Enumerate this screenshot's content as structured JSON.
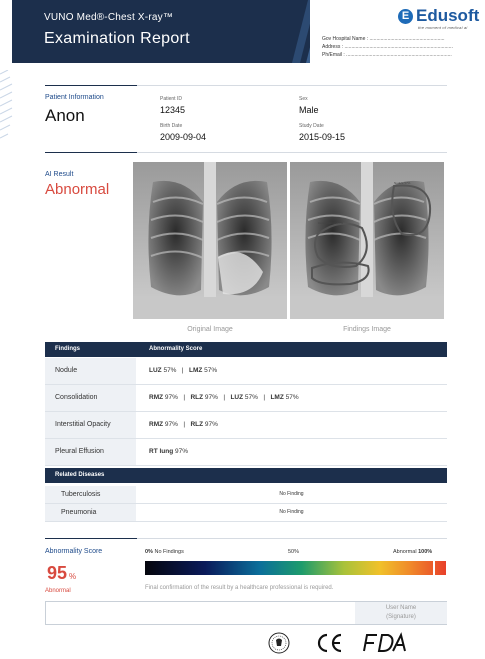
{
  "header": {
    "subtitle": "VUNO Med®-Chest X-ray™",
    "title": "Examination Report",
    "brand": "Edusoft",
    "brand_initial": "E",
    "brand_tagline": "the moment of medical ai",
    "hospital_name_label": "Gov Hospital Name : ......................................................",
    "address_label": "Address : ..............................................................................",
    "phone_label": "Ph/Email : ............................................................................"
  },
  "patient": {
    "section_label": "Patient Information",
    "name": "Anon",
    "id_label": "Patient ID",
    "id": "12345",
    "sex_label": "Sex",
    "sex": "Male",
    "birth_label": "Birth Date",
    "birth": "2009-09-04",
    "study_label": "Study Date",
    "study": "2015-09-15"
  },
  "ai": {
    "section_label": "AI Result",
    "result": "Abnormal",
    "original_caption": "Original Image",
    "findings_caption": "Findings Image"
  },
  "findings_table": {
    "col1": "Findings",
    "col2": "Abnormality Score",
    "rows": [
      {
        "name": "Nodule",
        "zones": [
          {
            "z": "LUZ",
            "p": "57%"
          },
          {
            "z": "LMZ",
            "p": "57%"
          }
        ]
      },
      {
        "name": "Consolidation",
        "zones": [
          {
            "z": "RMZ",
            "p": "97%"
          },
          {
            "z": "RLZ",
            "p": "97%"
          },
          {
            "z": "LUZ",
            "p": "57%"
          },
          {
            "z": "LMZ",
            "p": "57%"
          }
        ]
      },
      {
        "name": "Interstitial Opacity",
        "zones": [
          {
            "z": "RMZ",
            "p": "97%"
          },
          {
            "z": "RLZ",
            "p": "97%"
          }
        ]
      },
      {
        "name": "Pleural Effusion",
        "zones": [
          {
            "z": "RT lung",
            "p": "97%"
          }
        ]
      }
    ]
  },
  "diseases_table": {
    "header": "Related Diseases",
    "rows": [
      {
        "name": "Tuberculosis",
        "value": "No Finding"
      },
      {
        "name": "Pneumonia",
        "value": "No Finding"
      }
    ]
  },
  "abnormality": {
    "section_label": "Abnormality Score",
    "score": "95",
    "unit": "%",
    "status": "Abnormal",
    "scale_min_num": "0%",
    "scale_min_text": "No Findings",
    "scale_mid": "50%",
    "scale_max_text": "Abnormal",
    "scale_max_num": "100%",
    "level_fraction": 0.96,
    "confirm_note": "Final confirmation of the result by a healthcare professional is required.",
    "signature_line1": "User Name",
    "signature_line2": "(Signature)"
  },
  "footer": {
    "icons": [
      "seal-icon",
      "ce-mark-icon",
      "fda-icon"
    ]
  },
  "colors": {
    "navy": "#1c2f4c",
    "accent_red": "#d84a3f",
    "brand_blue": "#1e5aa0"
  }
}
